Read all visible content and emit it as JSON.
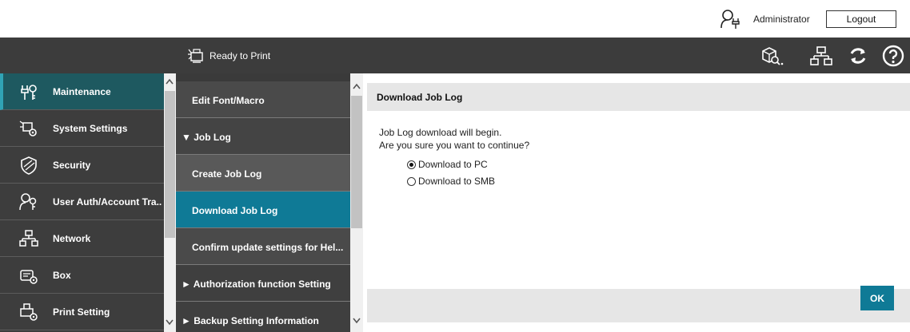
{
  "topbar": {
    "user_label": "Administrator",
    "logout_label": "Logout"
  },
  "header": {
    "status_label": "Ready to Print",
    "icons": [
      "search-device-icon",
      "network-icon",
      "refresh-icon",
      "help-icon"
    ]
  },
  "leftnav": {
    "items": [
      {
        "label": "Maintenance",
        "icon": "maintenance-icon",
        "active": true
      },
      {
        "label": "System Settings",
        "icon": "system-settings-icon"
      },
      {
        "label": "Security",
        "icon": "security-icon"
      },
      {
        "label": "User Auth/Account Tra..",
        "icon": "user-auth-icon"
      },
      {
        "label": "Network",
        "icon": "network-icon"
      },
      {
        "label": "Box",
        "icon": "box-icon"
      },
      {
        "label": "Print Setting",
        "icon": "print-setting-icon"
      }
    ]
  },
  "midnav": {
    "items": [
      {
        "label": "Edit Font/Macro"
      },
      {
        "label": "▼ Job Log"
      },
      {
        "label": "Create Job Log"
      },
      {
        "label": "Download Job Log",
        "selected": true
      },
      {
        "label": "Confirm update settings for Hel..."
      },
      {
        "label": "► Authorization function Setting"
      },
      {
        "label": "► Backup Setting Information"
      }
    ]
  },
  "content": {
    "title": "Download Job Log",
    "message_line1": "Job Log download will begin.",
    "message_line2": "Are you sure you want to continue?",
    "options": [
      {
        "label": "Download to PC",
        "checked": true
      },
      {
        "label": "Download to SMB",
        "checked": false
      }
    ],
    "ok_label": "OK"
  },
  "colors": {
    "header_bg": "#3c3c3c",
    "nav_active_bg": "#1e5960",
    "selected_bg": "#0f7a96",
    "ok_button": "#0f7a96"
  }
}
